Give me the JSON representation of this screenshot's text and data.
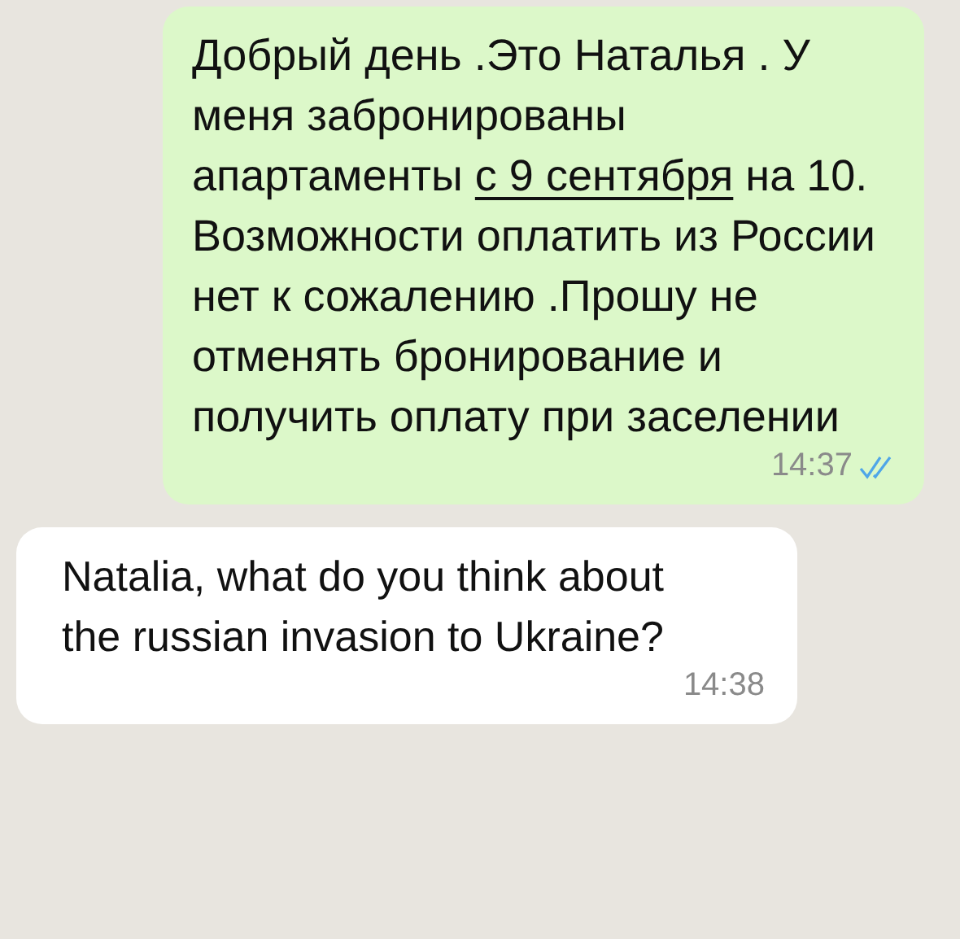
{
  "messages": [
    {
      "kind": "outgoing",
      "parts": [
        {
          "kind": "text",
          "text": "Добрый день .Это Наталья . У меня забронированы апартаменты "
        },
        {
          "kind": "link",
          "text": "с 9 сентября"
        },
        {
          "kind": "text",
          "text": " на 10. Возможности оплатить из России нет к сожалению .Прошу не отменять бронирование и получить оплату при заселении"
        }
      ],
      "time": "14:37",
      "read": true
    },
    {
      "kind": "incoming",
      "parts": [
        {
          "kind": "text",
          "text": "Natalia, what do you think about the russian invasion to Ukraine?"
        }
      ],
      "time": "14:38"
    }
  ]
}
